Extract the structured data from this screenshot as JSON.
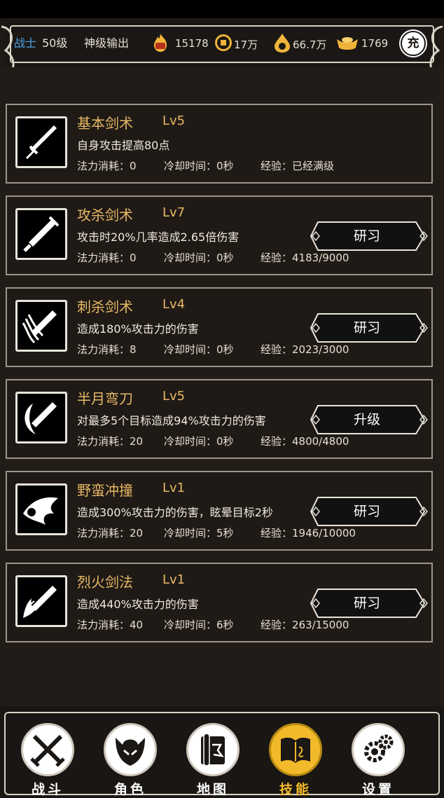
{
  "header": {
    "class_name": "战士",
    "level": "50级",
    "title": "神级输出",
    "power": "15178",
    "coins": "17万",
    "gold": "66.7万",
    "ingots": "1769",
    "charge_label": "充"
  },
  "skills": [
    {
      "name": "基本剑术",
      "level": "Lv5",
      "desc": "自身攻击提高80点",
      "mp": "法力消耗：0",
      "cd": "冷却时间：0秒",
      "exp": "经验：已经满级",
      "button": ""
    },
    {
      "name": "攻杀剑术",
      "level": "Lv7",
      "desc": "攻击时20%几率造成2.65倍伤害",
      "mp": "法力消耗：0",
      "cd": "冷却时间：0秒",
      "exp": "经验：4183/9000",
      "button": "研习"
    },
    {
      "name": "刺杀剑术",
      "level": "Lv4",
      "desc": "造成180%攻击力的伤害",
      "mp": "法力消耗：8",
      "cd": "冷却时间：0秒",
      "exp": "经验：2023/3000",
      "button": "研习"
    },
    {
      "name": "半月弯刀",
      "level": "Lv5",
      "desc": "对最多5个目标造成94%攻击力的伤害",
      "mp": "法力消耗：20",
      "cd": "冷却时间：0秒",
      "exp": "经验：4800/4800",
      "button": "升级"
    },
    {
      "name": "野蛮冲撞",
      "level": "Lv1",
      "desc": "造成300%攻击力的伤害，眩晕目标2秒",
      "mp": "法力消耗：20",
      "cd": "冷却时间：5秒",
      "exp": "经验：1946/10000",
      "button": "研习"
    },
    {
      "name": "烈火剑法",
      "level": "Lv1",
      "desc": "造成440%攻击力的伤害",
      "mp": "法力消耗：40",
      "cd": "冷却时间：6秒",
      "exp": "经验：263/15000",
      "button": "研习"
    }
  ],
  "nav": [
    {
      "label": "战斗",
      "icon": "crossed-swords-icon"
    },
    {
      "label": "角色",
      "icon": "helmet-icon"
    },
    {
      "label": "地图",
      "icon": "scroll-map-icon"
    },
    {
      "label": "技能",
      "icon": "skill-book-icon"
    },
    {
      "label": "设置",
      "icon": "gears-icon"
    }
  ],
  "colors": {
    "background": "#211c18",
    "skill_name": "#e7b865",
    "class_blue": "#4ba3e6",
    "active_nav": "#f2b92a"
  }
}
